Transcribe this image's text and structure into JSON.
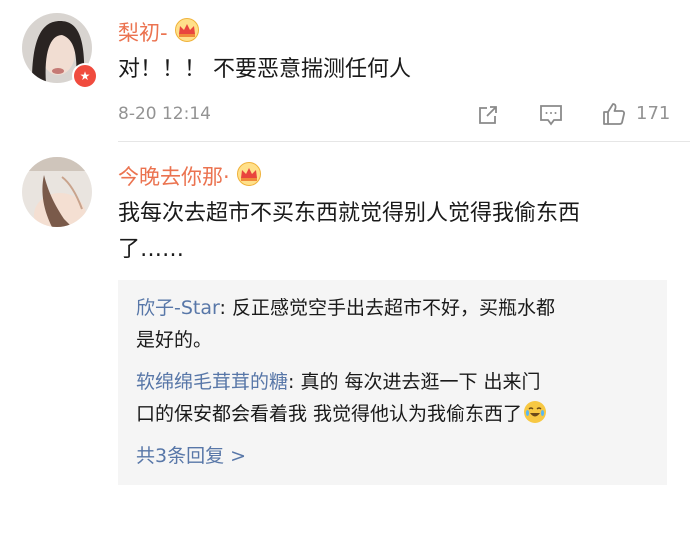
{
  "comments": [
    {
      "username": "梨初-",
      "text": "对！！！ 不要恶意揣测任何人",
      "time": "8-20 12:14",
      "likes": "171"
    },
    {
      "username": "今晚去你那·",
      "text_line1": "我每次去超市不买东西就觉得别人觉得我偷东西",
      "text_line2": "了……"
    }
  ],
  "replies": [
    {
      "name": "欣子-Star",
      "sep": ": ",
      "line1": "反正感觉空手出去超市不好，买瓶水都",
      "line2": "是好的。"
    },
    {
      "name": "软绵绵毛茸茸的糖",
      "sep": ": ",
      "line1": "真的 每次进去逛一下 出来门",
      "line2": "口的保安都会看着我 我觉得他认为我偷东西了"
    }
  ],
  "more_replies": "共3条回复 >",
  "colors": {
    "username": "#eb7350",
    "reply_name": "#5877a8",
    "meta": "#939393",
    "reply_bg": "#f5f5f5",
    "badge": "#f04b3e"
  },
  "icons": [
    "share-icon",
    "comment-icon",
    "like-icon",
    "crown-icon",
    "verified-badge",
    "laugh-cry-emoji"
  ]
}
